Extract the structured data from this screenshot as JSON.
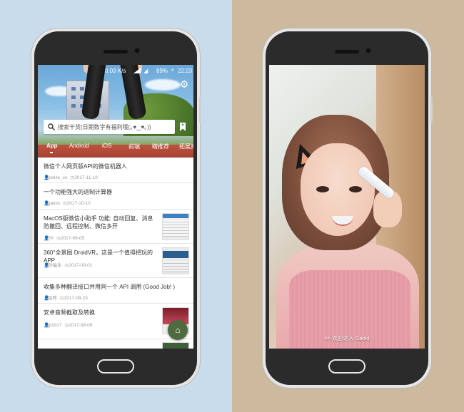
{
  "left_phone": {
    "status_bar": {
      "net_speed": "0.03 K/s",
      "battery": "89%",
      "time": "22:23"
    },
    "search": {
      "placeholder": "搜索干货(日期数字有福利哦(｡♥‿♥｡))"
    },
    "tabs": [
      "App",
      "Android",
      "iOS",
      "前端",
      "瞎推荐",
      "拓展资"
    ],
    "active_tab": "App",
    "items": [
      {
        "title": "微信个人网页版API的微信机器人",
        "author": "joeHe_cn",
        "date": "2017-11-10",
        "has_thumb": false
      },
      {
        "title": "一个功能强大的进制计算器",
        "author": "galois",
        "date": "2017-10-10",
        "has_thumb": false
      },
      {
        "title": "MacOS版微信小助手 功能: 自动回复、消息防撤回、远程控制、微信多开",
        "author": "TK",
        "date": "2017-09-05",
        "has_thumb": true
      },
      {
        "title": "360°全景图 DroidVR，这是一个值得把玩的APP",
        "author": "孙福生",
        "date": "2017-09-01",
        "has_thumb": true
      },
      {
        "title": "收集多种翻译接口并用同一个 API 调用 (Good Job! )",
        "author": "咕咚",
        "date": "2017-08-23",
        "has_thumb": false
      },
      {
        "title": "安卓音频截取及转换",
        "author": "jp1017",
        "date": "2017-08-09",
        "has_thumb": true
      }
    ]
  },
  "right_phone": {
    "welcome_text": ">> 欢迎进入 GankI"
  }
}
